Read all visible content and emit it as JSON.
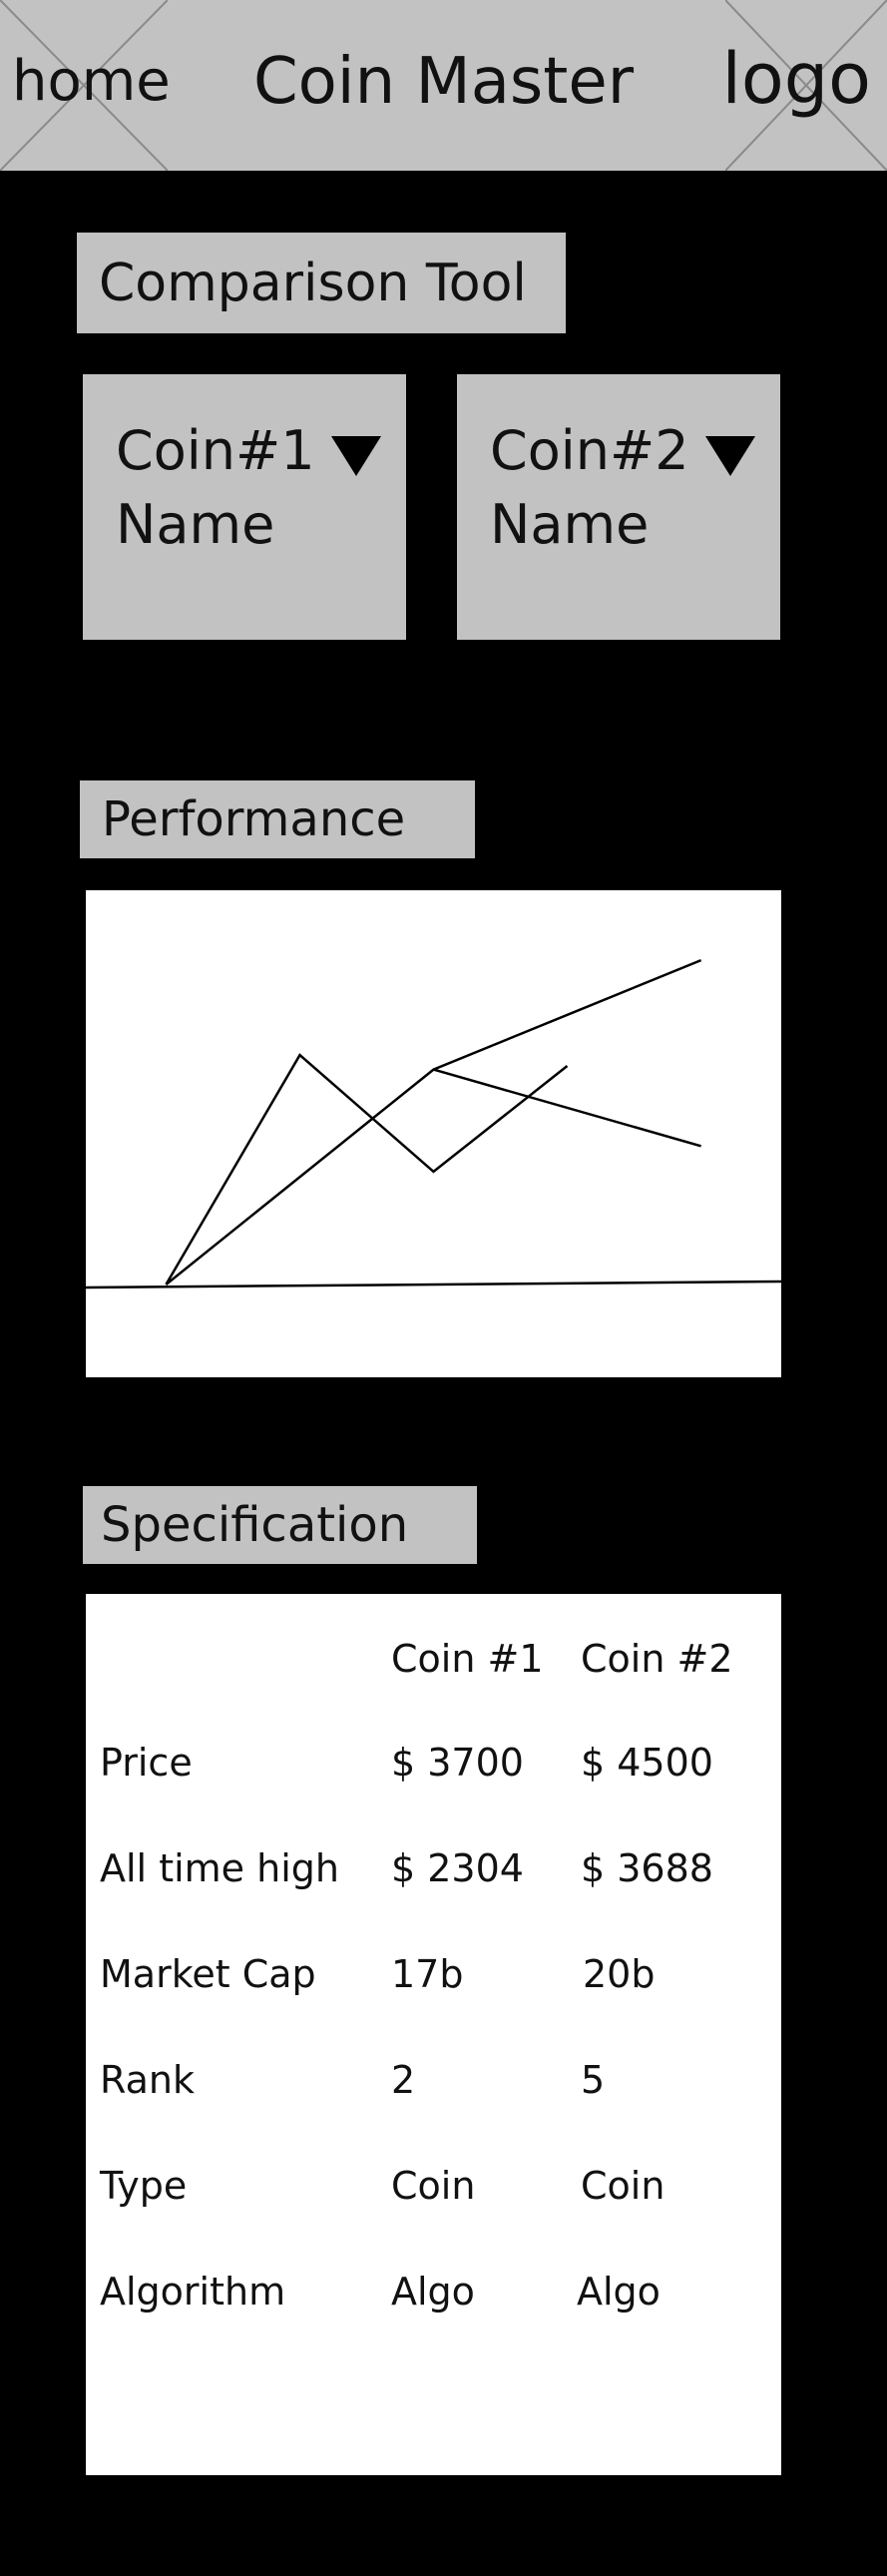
{
  "header": {
    "home_label": "home",
    "title": "Coin Master",
    "logo_label": "logo"
  },
  "comparison": {
    "title": "Comparison Tool",
    "coin1": {
      "label": "Coin#1 Name"
    },
    "coin2": {
      "label": "Coin#2 Name"
    }
  },
  "performance": {
    "title": "Performance"
  },
  "chart_data": {
    "type": "line",
    "title": "",
    "xlabel": "",
    "ylabel": "",
    "x": [
      0,
      1,
      2,
      3,
      4
    ],
    "xlim": [
      -0.6,
      4.6
    ],
    "ylim": [
      0,
      10
    ],
    "grid": false,
    "legend": "none",
    "series": [
      {
        "values": [
          0,
          6.3,
          3.1,
          6.0,
          null
        ],
        "color": "#000000"
      },
      {
        "values": [
          0,
          null,
          5.9,
          null,
          8.9
        ],
        "color": "#000000"
      },
      {
        "values": [
          null,
          null,
          5.9,
          null,
          3.8
        ],
        "color": "#000000"
      }
    ]
  },
  "specification": {
    "title": "Specification",
    "columns": [
      "",
      "Coin #1",
      "Coin #2"
    ],
    "rows": [
      {
        "label": "Price",
        "coin1": "$ 3700",
        "coin2": "$ 4500"
      },
      {
        "label": "All time high",
        "coin1": "$ 2304",
        "coin2": "$ 3688"
      },
      {
        "label": "Market Cap",
        "coin1": "17b",
        "coin2": "20b"
      },
      {
        "label": "Rank",
        "coin1": "2",
        "coin2": "5"
      },
      {
        "label": "Type",
        "coin1": "Coin",
        "coin2": "Coin"
      },
      {
        "label": "Algorithm",
        "coin1": "Algo",
        "coin2": "Algo"
      }
    ]
  },
  "colors": {
    "background": "#000000",
    "panel": "#c2c2c2",
    "chart_bg": "#ffffff",
    "line": "#000000",
    "text": "#111111"
  }
}
